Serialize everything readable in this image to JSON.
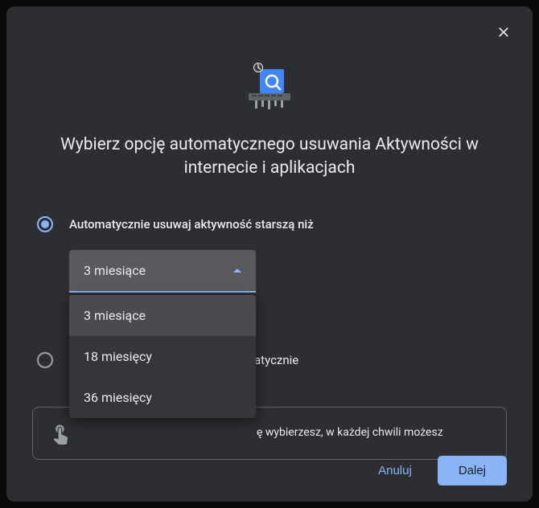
{
  "dialog": {
    "title": "Wybierz opcję automatycznego usuwania Aktywności w internecie i aplikacjach"
  },
  "options": {
    "auto_delete": {
      "label": "Automatycznie usuwaj aktywność starszą niż",
      "selected": true,
      "duration_selected": "3 miesiące",
      "durations": [
        "3 miesiące",
        "18 miesięcy",
        "36 miesięcy"
      ]
    },
    "no_auto_delete": {
      "label_suffix": "atycznie",
      "selected": false
    }
  },
  "info": {
    "text_suffix": "ę wybierzesz, w każdej chwili możesz"
  },
  "footer": {
    "cancel": "Anuluj",
    "next": "Dalej"
  }
}
